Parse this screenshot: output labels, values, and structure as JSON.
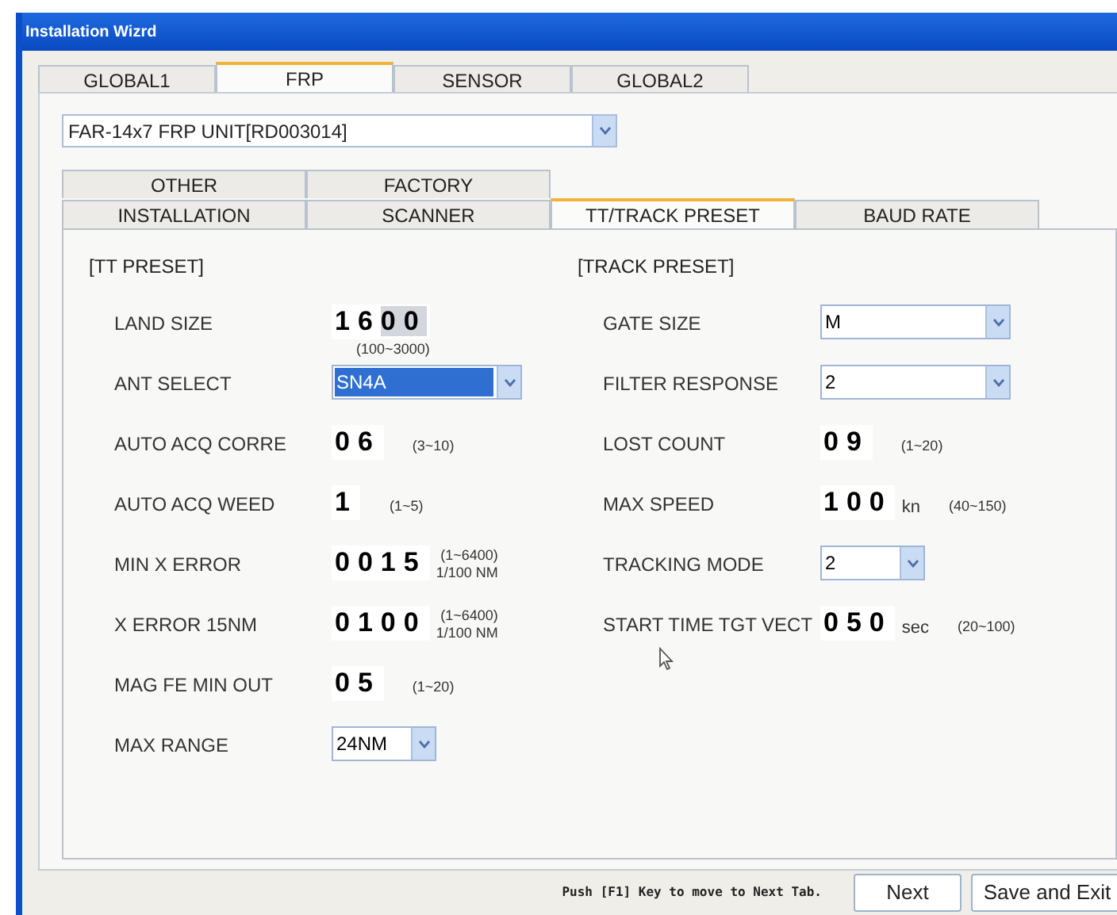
{
  "window": {
    "title": "Installation Wizrd"
  },
  "tabs": [
    {
      "label": "GLOBAL1",
      "selected": false
    },
    {
      "label": "FRP",
      "selected": true
    },
    {
      "label": "SENSOR",
      "selected": false
    },
    {
      "label": "GLOBAL2",
      "selected": false
    }
  ],
  "unit_select": {
    "value": "FAR-14x7 FRP UNIT[RD003014]"
  },
  "sub_tabs_upper": [
    {
      "label": "OTHER",
      "selected": false
    },
    {
      "label": "FACTORY",
      "selected": false
    }
  ],
  "sub_tabs": [
    {
      "label": "INSTALLATION",
      "selected": false
    },
    {
      "label": "SCANNER",
      "selected": false
    },
    {
      "label": "TT/TRACK PRESET",
      "selected": true
    },
    {
      "label": "BAUD RATE",
      "selected": false
    }
  ],
  "sections": [
    {
      "heading": "[TT PRESET]",
      "fields": [
        {
          "label": "LAND SIZE",
          "kind": "digits",
          "value": "16",
          "selected_text": "00",
          "note_below": "(100~3000)"
        },
        {
          "label": "ANT SELECT",
          "kind": "select",
          "value": "SN4A",
          "focused": true
        },
        {
          "label": "AUTO ACQ CORRE",
          "kind": "digits",
          "value": "06",
          "range": "(3~10)"
        },
        {
          "label": "AUTO ACQ WEED",
          "kind": "digits",
          "value": "1",
          "range": "(1~5)"
        },
        {
          "label": "MIN X ERROR",
          "kind": "digits",
          "value": "0015",
          "range": "(1~6400)",
          "range_unit": "1/100 NM"
        },
        {
          "label": "X ERROR 15NM",
          "kind": "digits",
          "value": "0100",
          "range": "(1~6400)",
          "range_unit": "1/100 NM"
        },
        {
          "label": "MAG FE MIN OUT",
          "kind": "digits",
          "value": "05",
          "range": "(1~20)"
        },
        {
          "label": "MAX RANGE",
          "kind": "short_select",
          "value": "24NM",
          "focused": false
        }
      ]
    },
    {
      "heading": "[TRACK PRESET]",
      "fields": [
        {
          "label": "GATE SIZE",
          "kind": "select",
          "value": "M",
          "focused": false
        },
        {
          "label": "FILTER RESPONSE",
          "kind": "select",
          "value": "2",
          "focused": false
        },
        {
          "label": "LOST COUNT",
          "kind": "digits",
          "value": "09",
          "range": "(1~20)"
        },
        {
          "label": "MAX SPEED",
          "kind": "digits",
          "value": "100",
          "unit": "kn",
          "range": "(40~150)"
        },
        {
          "label": "TRACKING MODE",
          "kind": "short_select",
          "value": "2",
          "focused": false
        },
        {
          "label": "START TIME TGT VECT",
          "kind": "digits",
          "value": "050",
          "unit": "sec",
          "range": "(20~100)"
        }
      ]
    }
  ],
  "footer": {
    "hint": "Push [F1] Key to move to Next Tab.",
    "buttons": [
      "Next",
      "Save and Exit"
    ]
  }
}
